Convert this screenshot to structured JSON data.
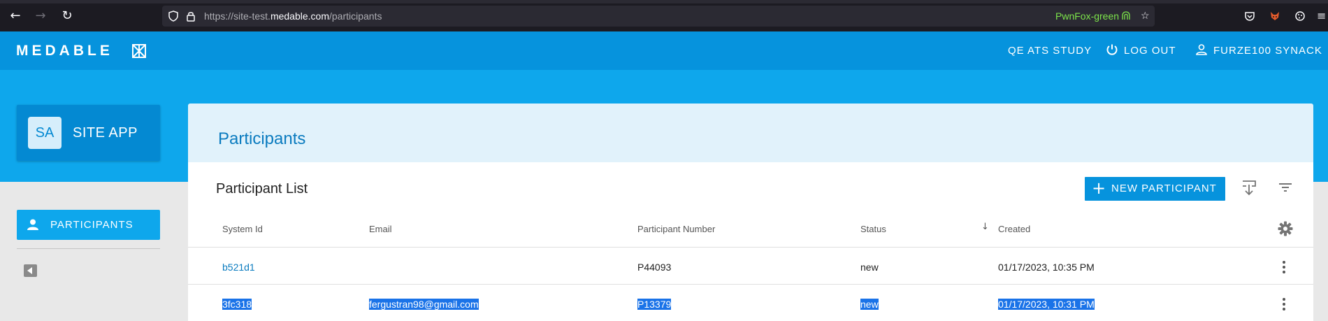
{
  "browser": {
    "url_prefix": "https://site-test.",
    "url_host": "medable.com",
    "url_path": "/participants",
    "container": "PwnFox-green"
  },
  "header": {
    "logo": "MEDABLE",
    "study": "QE ATS STUDY",
    "logout": "LOG OUT",
    "user": "FURZE100 SYNACK"
  },
  "site": {
    "initials": "SA",
    "name": "SITE APP"
  },
  "sidebar": {
    "items": [
      {
        "label": "PARTICIPANTS"
      }
    ]
  },
  "main": {
    "page_title": "Participants",
    "card_title": "Participant List",
    "new_button": "NEW PARTICIPANT",
    "columns": [
      "System Id",
      "Email",
      "Participant Number",
      "Status",
      "Created"
    ],
    "rows": [
      {
        "system_id": "b521d1",
        "email": "",
        "number": "P44093",
        "status": "new",
        "created": "01/17/2023, 10:35 PM",
        "selected": false
      },
      {
        "system_id": "3fc318",
        "email": "fergustran98@gmail.com",
        "number": "P13379",
        "status": "new",
        "created": "01/17/2023, 10:31 PM",
        "selected": true
      }
    ]
  },
  "colors": {
    "header": "#0693dd",
    "band": "#0ea7ec",
    "accent": "#0a7bbf",
    "selection": "#1a73e8"
  },
  "icons": [
    "back-arrow-icon",
    "forward-arrow-icon",
    "reload-icon",
    "shield-icon",
    "lock-icon",
    "fingerprint-icon",
    "star-icon",
    "pocket-icon",
    "fox-icon",
    "extensions-icon",
    "power-icon",
    "user-icon",
    "person-icon",
    "plus-icon",
    "download-icon",
    "filter-icon",
    "gear-icon",
    "sort-down-icon",
    "kebab-menu-icon"
  ]
}
